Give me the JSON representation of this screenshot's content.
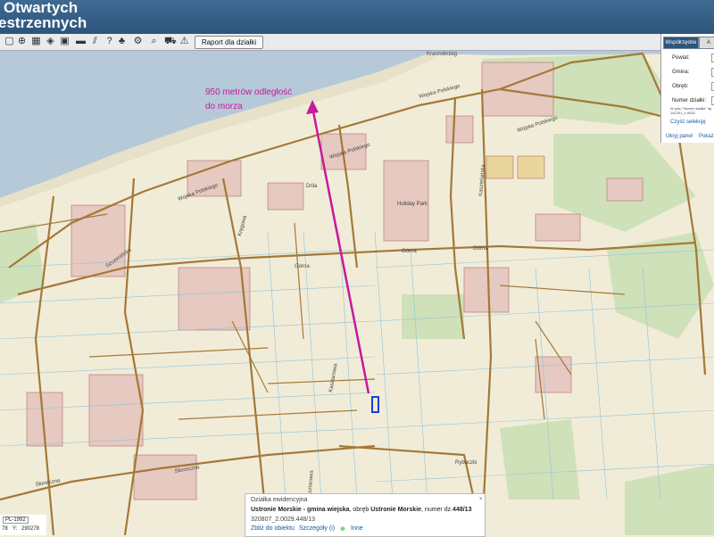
{
  "header": {
    "title_line1": "Otwartych",
    "title_line2": "estrzennych"
  },
  "toolbar": {
    "icons": [
      "select-icon",
      "pan-icon",
      "table-icon",
      "layers-icon",
      "hatch-icon",
      "help-icon",
      "tree-icon",
      "identify-icon",
      "zoom-icon",
      "cart-icon",
      "warning-icon"
    ],
    "raport_label": "Raport dla działki"
  },
  "panel": {
    "tab_active": "Współrzędne",
    "tab_other": "A",
    "fields": [
      "Powiat:",
      "Gmina:",
      "Obręb:",
      "Numer działki:"
    ],
    "note": "W polu \"Numer działki\" np. 141201_1.0032",
    "clear_label": "Czyść selekcję",
    "hide_label": "Ukryj panel",
    "show_label": "Pokaż"
  },
  "annotation": {
    "line1": "950 metrów odległość",
    "line2": "do morza",
    "color": "#c8189c"
  },
  "map": {
    "sea_color": "#b5c9d8",
    "land_color": "#f1ecd8",
    "street_labels": [
      "Krasnobrzeg",
      "Wojska Polskiego",
      "Wojska Polskiego",
      "Wojska Polskiego",
      "Wojska Polskiego",
      "Drila",
      "Holiday Park",
      "Górna",
      "Górna",
      "Górna",
      "Kasztanowa",
      "Kasztanowa",
      "Słoneczna",
      "Słoneczna",
      "Rybaczki",
      "Szczecińska",
      "Kręgowa",
      "Kasztelańska"
    ]
  },
  "popup": {
    "heading": "Działka ewidencyjna",
    "title_bold": "Ustronie Morskie - gmina wiejska",
    "title_mid": ", obręb ",
    "obreb": "Ustronie Morskie",
    "numer_prefix": ", numer dz.",
    "numer": "448/13",
    "id": "320807_2.0029.448/13",
    "zoom_link": "Zbliż do obiektu",
    "details_link": "Szczegóły (i)",
    "other_link": "Inne",
    "pin_icon": "×"
  },
  "coords": {
    "crs": "PL-1992",
    "x_value": "78",
    "y_label": "Y:",
    "y_value": "290278"
  }
}
